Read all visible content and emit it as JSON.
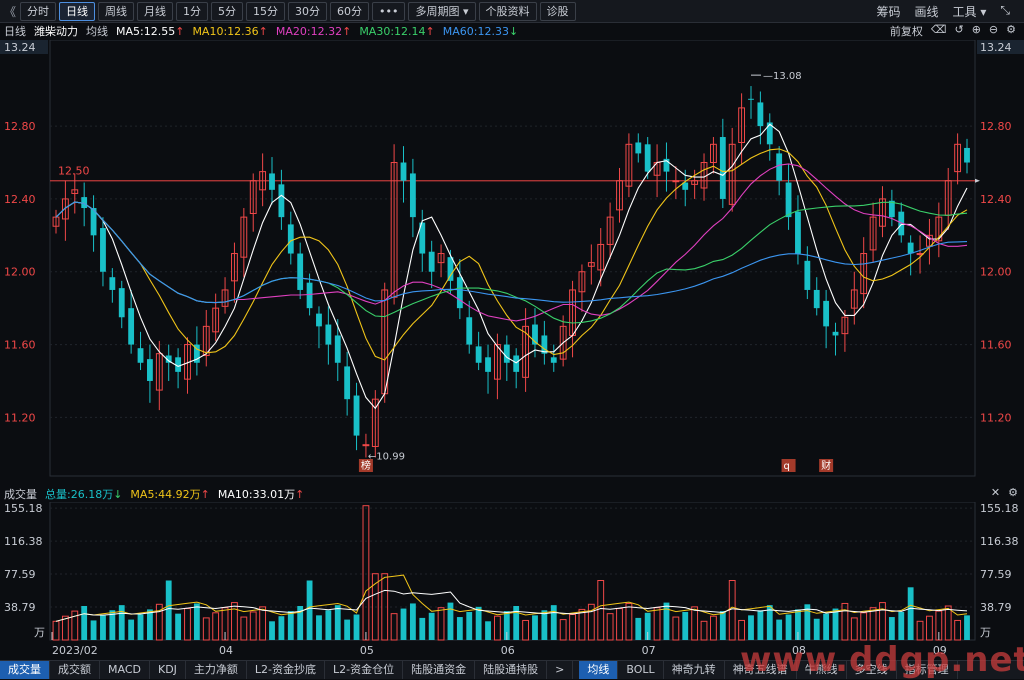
{
  "toolbar": {
    "back": "《",
    "buttons": [
      "分时",
      "日线",
      "周线",
      "月线",
      "1分",
      "5分",
      "15分",
      "30分",
      "60分",
      "•••",
      "多周期图 ▾",
      "个股资料",
      "诊股"
    ],
    "active_index": 1,
    "right": [
      "筹码",
      "画线",
      "工具 ▾",
      "⤡"
    ]
  },
  "info": {
    "period": "日线",
    "name": "潍柴动力",
    "avg_label": "均线",
    "ma": [
      {
        "text": "MA5:12.55",
        "arrow": "↑",
        "color": "#ffffff"
      },
      {
        "text": "MA10:12.36",
        "arrow": "↑",
        "color": "#f0c419"
      },
      {
        "text": "MA20:12.32",
        "arrow": "↑",
        "color": "#e040c0"
      },
      {
        "text": "MA30:12.14",
        "arrow": "↑",
        "color": "#3ad06a"
      },
      {
        "text": "MA60:12.33",
        "arrow": "↓",
        "color": "#3b95f0"
      }
    ],
    "right": [
      "前复权",
      "⌫",
      "↺",
      "⊕",
      "⊖",
      "⚙"
    ]
  },
  "price_axis": [
    "13.24",
    "12.80",
    "12.40",
    "12.00",
    "11.60",
    "11.20"
  ],
  "annotations": {
    "high": "13.08",
    "low": "10.99",
    "hline": "12.50",
    "tag1": "榜",
    "tag2": "q",
    "tag3": "财"
  },
  "volume_info": {
    "label": "成交量",
    "total": "总量:26.18万",
    "total_arrow": "↓",
    "ma5": "MA5:44.92万",
    "ma5_arrow": "↑",
    "ma10": "MA10:33.01万",
    "ma10_arrow": "↑"
  },
  "volume_axis": [
    "155.18",
    "116.38",
    "77.59",
    "38.79",
    "万"
  ],
  "date_axis": [
    "2023/02",
    "04",
    "05",
    "06",
    "07",
    "08",
    "09"
  ],
  "bottom_tabs_left": [
    "成交量",
    "成交额",
    "MACD",
    "KDJ",
    "主力净额",
    "L2-资金抄底",
    "L2-资金仓位",
    "陆股通资金",
    "陆股通持股",
    ">"
  ],
  "bottom_tabs_right": [
    "均线",
    "BOLL",
    "神奇九转",
    "神奇五线谱",
    "牛熊线",
    "多空线",
    "指标管理"
  ],
  "watermark": "www.ddgp.net",
  "colors": {
    "up": "#f04848",
    "down": "#19c0c8",
    "bg": "#0b0d11"
  },
  "chart_data": {
    "type": "candlestick",
    "price_range": [
      10.9,
      13.24
    ],
    "closes": [
      12.3,
      12.4,
      12.45,
      12.35,
      12.2,
      12.0,
      11.9,
      11.75,
      11.6,
      11.5,
      11.4,
      11.55,
      11.5,
      11.45,
      11.6,
      11.5,
      11.7,
      11.8,
      11.9,
      12.1,
      12.3,
      12.5,
      12.55,
      12.45,
      12.3,
      12.1,
      11.9,
      11.8,
      11.7,
      11.6,
      11.5,
      11.3,
      11.1,
      11.05,
      11.3,
      11.9,
      12.6,
      12.5,
      12.3,
      12.1,
      12.0,
      12.1,
      11.95,
      11.8,
      11.6,
      11.5,
      11.45,
      11.6,
      11.5,
      11.45,
      11.7,
      11.6,
      11.55,
      11.5,
      11.7,
      11.9,
      12.0,
      12.05,
      12.15,
      12.3,
      12.5,
      12.7,
      12.65,
      12.55,
      12.6,
      12.55,
      12.5,
      12.45,
      12.5,
      12.6,
      12.7,
      12.4,
      12.7,
      12.9,
      12.95,
      12.8,
      12.7,
      12.5,
      12.3,
      12.1,
      11.9,
      11.8,
      11.7,
      11.65,
      11.75,
      11.9,
      12.1,
      12.3,
      12.4,
      12.3,
      12.2,
      12.1,
      12.1,
      12.2,
      12.3,
      12.5,
      12.7,
      12.6
    ],
    "volume_range": [
      0,
      160
    ],
    "ma_volume_unit": "万"
  }
}
